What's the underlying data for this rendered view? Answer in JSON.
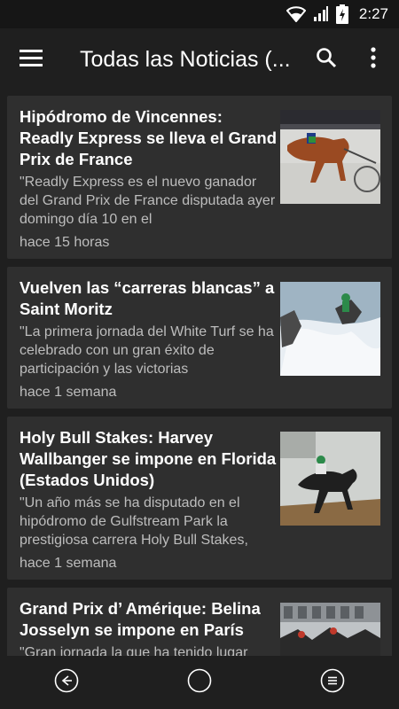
{
  "status_bar": {
    "time": "2:27",
    "battery_icon": "battery-charging-icon",
    "signal_icon": "cell-signal-icon",
    "wifi_icon": "wifi-icon"
  },
  "app_bar": {
    "title": "Todas las Noticias (...",
    "menu_icon": "menu-icon",
    "search_icon": "search-icon",
    "more_icon": "more-vert-icon"
  },
  "articles": [
    {
      "title": "Hipódromo de Vincennes: Readly Express se lleva el Grand Prix de France",
      "snippet": "\"Readly Express es el nuevo ganador del Grand Prix de France disputada ayer domingo día 10 en el",
      "time": "hace 15 horas"
    },
    {
      "title": "Vuelven las “carreras blancas” a Saint Moritz",
      "snippet": "\"La primera jornada del White Turf se ha celebrado con un gran éxito de participación y las victorias",
      "time": "hace 1 semana"
    },
    {
      "title": "Holy Bull Stakes: Harvey Wallbanger se impone en Florida (Estados Unidos)",
      "snippet": "\"Un año más se ha disputado en el hipódromo de Gulfstream Park la prestigiosa carrera Holy Bull Stakes,",
      "time": "hace 1 semana"
    },
    {
      "title": "Grand Prix d’ Amérique: Belina Josselyn se impone en París",
      "snippet": "\"Gran jornada la que ha tenido lugar",
      "time": ""
    }
  ],
  "nav_bar": {
    "back_icon": "back-icon",
    "home_icon": "home-icon",
    "recents_icon": "recents-icon"
  },
  "colors": {
    "background": "#1f1f1f",
    "card": "#2f2f2f",
    "text_primary": "#ffffff",
    "text_secondary": "#bdbdbd"
  }
}
